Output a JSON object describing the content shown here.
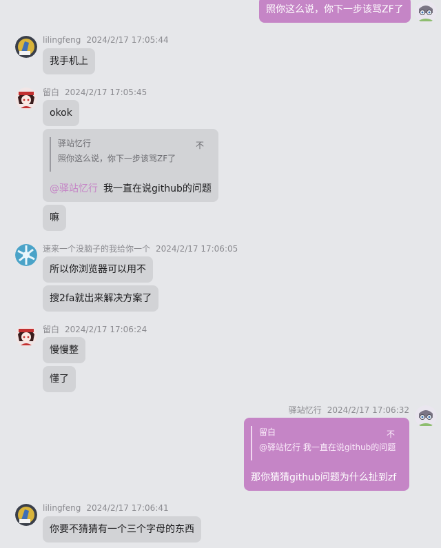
{
  "messages": {
    "m0": {
      "text": "照你这么说，你下一步该骂ZF了"
    },
    "m1": {
      "user": "lilingfeng",
      "time": "2024/2/17 17:05:44",
      "text": "我手机上"
    },
    "m2": {
      "user": "留白",
      "time": "2024/2/17 17:05:45",
      "text": "okok"
    },
    "m3": {
      "quote_name": "驿站忆行",
      "quote_text": "照你这么说，你下一步该骂ZF了",
      "quote_close": "不",
      "mention": "@驿站忆行",
      "text": "我一直在说github的问题"
    },
    "m4": {
      "text": "嘛"
    },
    "m5": {
      "user": "速来一个没脑子的我给你一个",
      "time": "2024/2/17 17:06:05",
      "text": "所以你浏览器可以用不"
    },
    "m6": {
      "text": "搜2fa就出来解决方案了"
    },
    "m7": {
      "user": "留白",
      "time": "2024/2/17 17:06:24",
      "text": "慢慢整"
    },
    "m8": {
      "text": "懂了"
    },
    "m9": {
      "user": "驿站忆行",
      "time": "2024/2/17 17:06:32",
      "quote_name": "留白",
      "quote_text": "@驿站忆行 我一直在说github的问题",
      "quote_close": "不",
      "text": "那你猜猜github问题为什么扯到zf"
    },
    "m10": {
      "user": "lilingfeng",
      "time": "2024/2/17 17:06:41",
      "text": "你要不猜猜有一个三个字母的东西"
    }
  },
  "colors": {
    "background": "#e6e7ea",
    "bubble_other": "#d2d3d6",
    "bubble_self": "#c585c6",
    "meta_text": "#8a8a8f",
    "mention": "#c585c6"
  }
}
